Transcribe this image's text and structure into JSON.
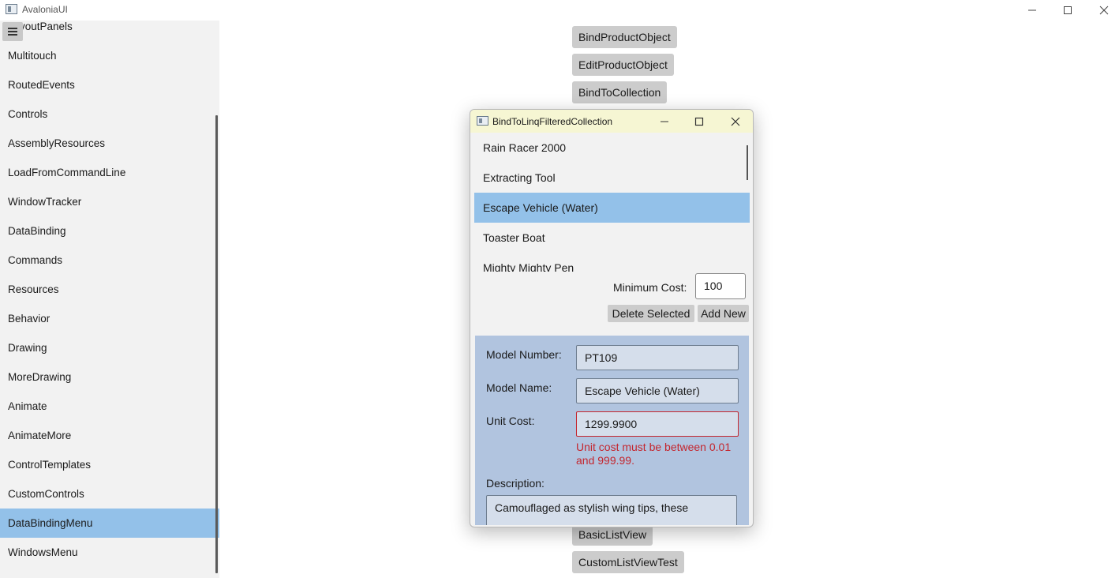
{
  "window": {
    "title": "AvaloniaUI"
  },
  "sidebar": {
    "items": [
      {
        "label": "LayoutPanels"
      },
      {
        "label": "Multitouch"
      },
      {
        "label": "RoutedEvents"
      },
      {
        "label": "Controls"
      },
      {
        "label": "AssemblyResources"
      },
      {
        "label": "LoadFromCommandLine"
      },
      {
        "label": "WindowTracker"
      },
      {
        "label": "DataBinding"
      },
      {
        "label": "Commands"
      },
      {
        "label": "Resources"
      },
      {
        "label": "Behavior"
      },
      {
        "label": "Drawing"
      },
      {
        "label": "MoreDrawing"
      },
      {
        "label": "Animate"
      },
      {
        "label": "AnimateMore"
      },
      {
        "label": "ControlTemplates"
      },
      {
        "label": "CustomControls"
      },
      {
        "label": "DataBindingMenu",
        "selected": true
      },
      {
        "label": "WindowsMenu"
      }
    ]
  },
  "main": {
    "buttons": [
      {
        "label": "BindProductObject"
      },
      {
        "label": "EditProductObject"
      },
      {
        "label": "BindToCollection"
      },
      {
        "label": "BasicListView"
      },
      {
        "label": "CustomListViewTest"
      }
    ]
  },
  "dialog": {
    "title": "BindToLinqFilteredCollection",
    "products": [
      {
        "name": "Rain Racer 2000"
      },
      {
        "name": "Extracting Tool"
      },
      {
        "name": "Escape Vehicle (Water)",
        "selected": true
      },
      {
        "name": "Toaster Boat"
      },
      {
        "name": "Mighty Mighty Pen"
      }
    ],
    "min_cost_label": "Minimum Cost:",
    "min_cost_value": "100",
    "delete_label": "Delete Selected",
    "add_label": "Add New",
    "details": {
      "model_number_label": "Model Number:",
      "model_number": "PT109",
      "model_name_label": "Model Name:",
      "model_name": "Escape Vehicle (Water)",
      "unit_cost_label": "Unit Cost:",
      "unit_cost": "1299.9900",
      "unit_cost_error": "Unit cost must be between 0.01 and 999.99.",
      "description_label": "Description:",
      "description": "Camouflaged as stylish wing tips, these"
    }
  },
  "colors": {
    "selection": "#93c1e9",
    "dialog_titlebar": "#f6f6d3",
    "details_panel": "#b1c4df",
    "error": "#c4262e",
    "button": "#cccccc"
  }
}
